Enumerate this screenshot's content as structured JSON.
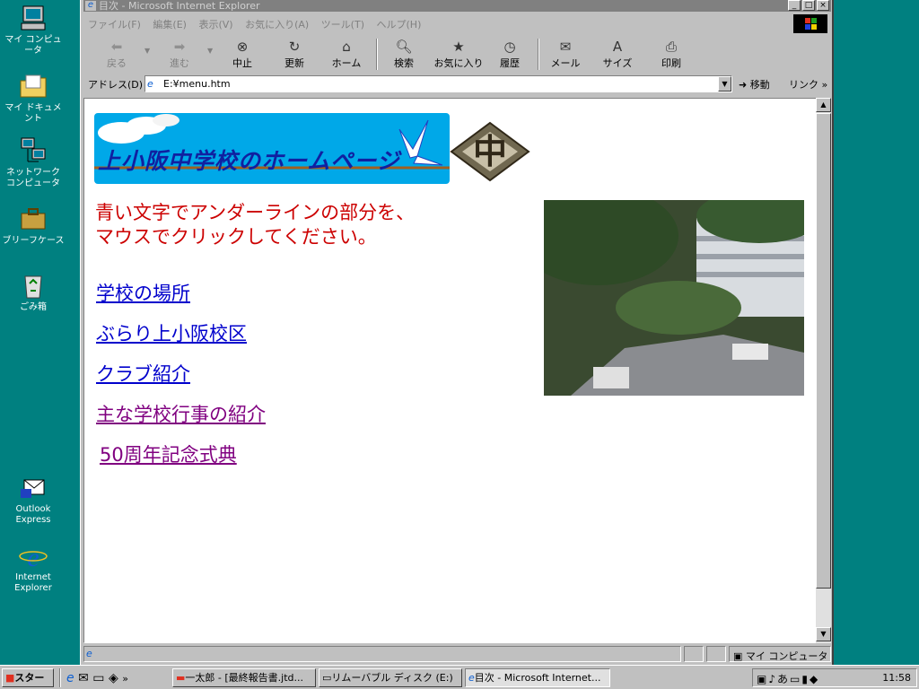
{
  "desktop": {
    "icons": [
      {
        "label": "マイ コンピュータ",
        "icon": "my-computer-icon"
      },
      {
        "label": "マイ ドキュメント",
        "icon": "my-documents-icon"
      },
      {
        "label": "ネットワーク コンピュータ",
        "icon": "network-icon"
      },
      {
        "label": "ブリーフケース",
        "icon": "briefcase-icon"
      },
      {
        "label": "ごみ箱",
        "icon": "recycle-bin-icon"
      },
      {
        "label": "Outlook Express",
        "icon": "outlook-icon"
      },
      {
        "label": "Internet Explorer",
        "icon": "ie-icon"
      }
    ]
  },
  "window": {
    "title": "目次 - Microsoft Internet Explorer",
    "menu": [
      "ファイル(F)",
      "編集(E)",
      "表示(V)",
      "お気に入り(A)",
      "ツール(T)",
      "ヘルプ(H)"
    ],
    "toolbar": {
      "back": "戻る",
      "forward": "進む",
      "stop": "中止",
      "refresh": "更新",
      "home": "ホーム",
      "search": "検索",
      "favorites": "お気に入り",
      "history": "履歴",
      "mail": "メール",
      "size": "サイズ",
      "print": "印刷"
    },
    "address": {
      "label": "アドレス(D)",
      "value": "E:¥menu.htm",
      "go": "移動",
      "links": "リンク"
    },
    "status": {
      "text": "",
      "zone": "マイ コンピュータ"
    }
  },
  "page": {
    "banner_title": "上小阪中学校のホームページ",
    "banner_emblem": "中",
    "instruction": [
      "青い文字でアンダーラインの部分を、",
      "マウスでクリックしてください。"
    ],
    "links": [
      {
        "text": "学校の場所",
        "visited": false
      },
      {
        "text": "ぶらり上小阪校区",
        "visited": false
      },
      {
        "text": "クラブ紹介",
        "visited": false
      },
      {
        "text": "主な学校行事の紹介",
        "visited": true
      },
      {
        "text": "50周年記念式典",
        "visited": true
      }
    ]
  },
  "taskbar": {
    "start": "スタート",
    "tasks": [
      "一太郎 - [最終報告書.jtd...",
      "リムーバブル ディスク (E:)",
      "目次 - Microsoft Internet..."
    ],
    "clock": "11:58"
  },
  "colors": {
    "desktop": "#008080",
    "link": "#0000cc",
    "visited": "#800080",
    "instruction": "#cc0000",
    "banner": "#00a8e8"
  }
}
